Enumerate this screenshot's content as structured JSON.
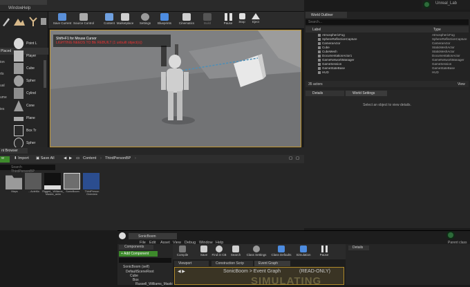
{
  "menu": {
    "window": "Window",
    "help": "Help"
  },
  "app_corner": {
    "title": "Unreal_Lab"
  },
  "modes": {
    "header": "Placed",
    "side_labels": [
      "ion",
      "rts",
      "ual",
      "ume",
      "ies"
    ],
    "items": [
      {
        "label": "Point L"
      },
      {
        "label": "Player"
      },
      {
        "label": "Cube"
      },
      {
        "label": "Spher"
      },
      {
        "label": "Cylind"
      },
      {
        "label": "Cone"
      },
      {
        "label": "Plane"
      },
      {
        "label": "Box Tr"
      },
      {
        "label": "Spher"
      }
    ]
  },
  "toolbar": {
    "buttons": [
      {
        "label": "Save Current",
        "color": "#5a8fd8"
      },
      {
        "label": "Source Control",
        "color": "#aaaaaa"
      },
      {
        "label": "Content",
        "color": "#6fa0e0"
      },
      {
        "label": "Marketplace",
        "color": "#cfcfcf"
      },
      {
        "label": "Settings",
        "color": "#9a9a9a"
      },
      {
        "label": "Blueprints",
        "color": "#4d8ce0"
      },
      {
        "label": "Cinematics",
        "color": "#cfcfcf"
      },
      {
        "label": "Build",
        "color": "#555555"
      },
      {
        "label": "Pause",
        "color": "#e0e0e0"
      },
      {
        "label": "Stop",
        "color": "#e0e0e0"
      },
      {
        "label": "Eject",
        "color": "#e0e0e0"
      }
    ]
  },
  "viewport": {
    "hint": "Shift+F1 for Mouse Cursor",
    "warning": "LIGHTING NEEDS TO BE REBUILT (1 unbuilt object(s))"
  },
  "outliner": {
    "tab": "World Outliner",
    "search_placeholder": "Search...",
    "col_label": "Label",
    "col_type": "Type",
    "rows": [
      {
        "label": "AtmosphericFog",
        "type": "AtmosphericFog"
      },
      {
        "label": "SphereReflectionCapture",
        "type": "SphereReflectionCapture"
      },
      {
        "label": "CameraActor",
        "type": "CameraActor"
      },
      {
        "label": "Cube",
        "type": "StaticMeshActor"
      },
      {
        "label": "CubeMesh",
        "type": "StaticMeshActor"
      },
      {
        "label": "DocumentationActor1",
        "type": "DocumentationActor"
      },
      {
        "label": "GameNetworkManager",
        "type": "GameNetworkManager"
      },
      {
        "label": "GameSession",
        "type": "GameSession"
      },
      {
        "label": "GameStateBase",
        "type": "GameStateBase"
      },
      {
        "label": "HUD",
        "type": "HUD"
      }
    ],
    "actor_count": "35 actors",
    "view_options": "View"
  },
  "details": {
    "tab_details": "Details",
    "tab_world": "World Settings",
    "empty_message": "Select an object to view details."
  },
  "content_browser": {
    "tab": "nt Browser",
    "new_label": "w",
    "import_label": "Import",
    "save_all_label": "Save All",
    "path": [
      "Content",
      "ThirdPersonBP"
    ],
    "search_placeholder": "Search ThirdPersonBP",
    "assets": [
      {
        "label": "Maps"
      },
      {
        "label": "...ActeMo"
      },
      {
        "label": "Rigged_ Williams_ Maskic_anim"
      },
      {
        "label": "SonicBoom"
      },
      {
        "label": "ThirdPerson Overview"
      }
    ]
  },
  "blueprint_window": {
    "tab": "SonicBoom",
    "menu": [
      "File",
      "Edit",
      "Asset",
      "View",
      "Debug",
      "Window",
      "Help"
    ],
    "parent_class": "Parent class",
    "components_tab": "Components",
    "add_component": "+ Add Component",
    "self_item": "SonicBoom (self)",
    "tree": [
      "DefaultSceneRoot",
      "Cube",
      "Box",
      "Russell_Williams_Maski"
    ],
    "toolbar": [
      {
        "label": "Compile",
        "color": "#7a7a7a"
      },
      {
        "label": "Save",
        "color": "#d0d0d0"
      },
      {
        "label": "Find in CB",
        "color": "#d0d0d0"
      },
      {
        "label": "Search",
        "color": "#d0d0d0"
      },
      {
        "label": "Class Settings",
        "color": "#9a9a9a"
      },
      {
        "label": "Class Defaults",
        "color": "#4d8ce0"
      },
      {
        "label": "Simulation",
        "color": "#4d8ce0"
      },
      {
        "label": "Pause",
        "color": "#e0e0e0"
      }
    ],
    "graph_tabs": [
      "Viewport",
      "Construction Scrip",
      "Event Graph"
    ],
    "graph_title": "SonicBoom > Event Graph",
    "read_only": "(READ-ONLY)",
    "simulating": "SIMULATING",
    "details_tab": "Details"
  }
}
